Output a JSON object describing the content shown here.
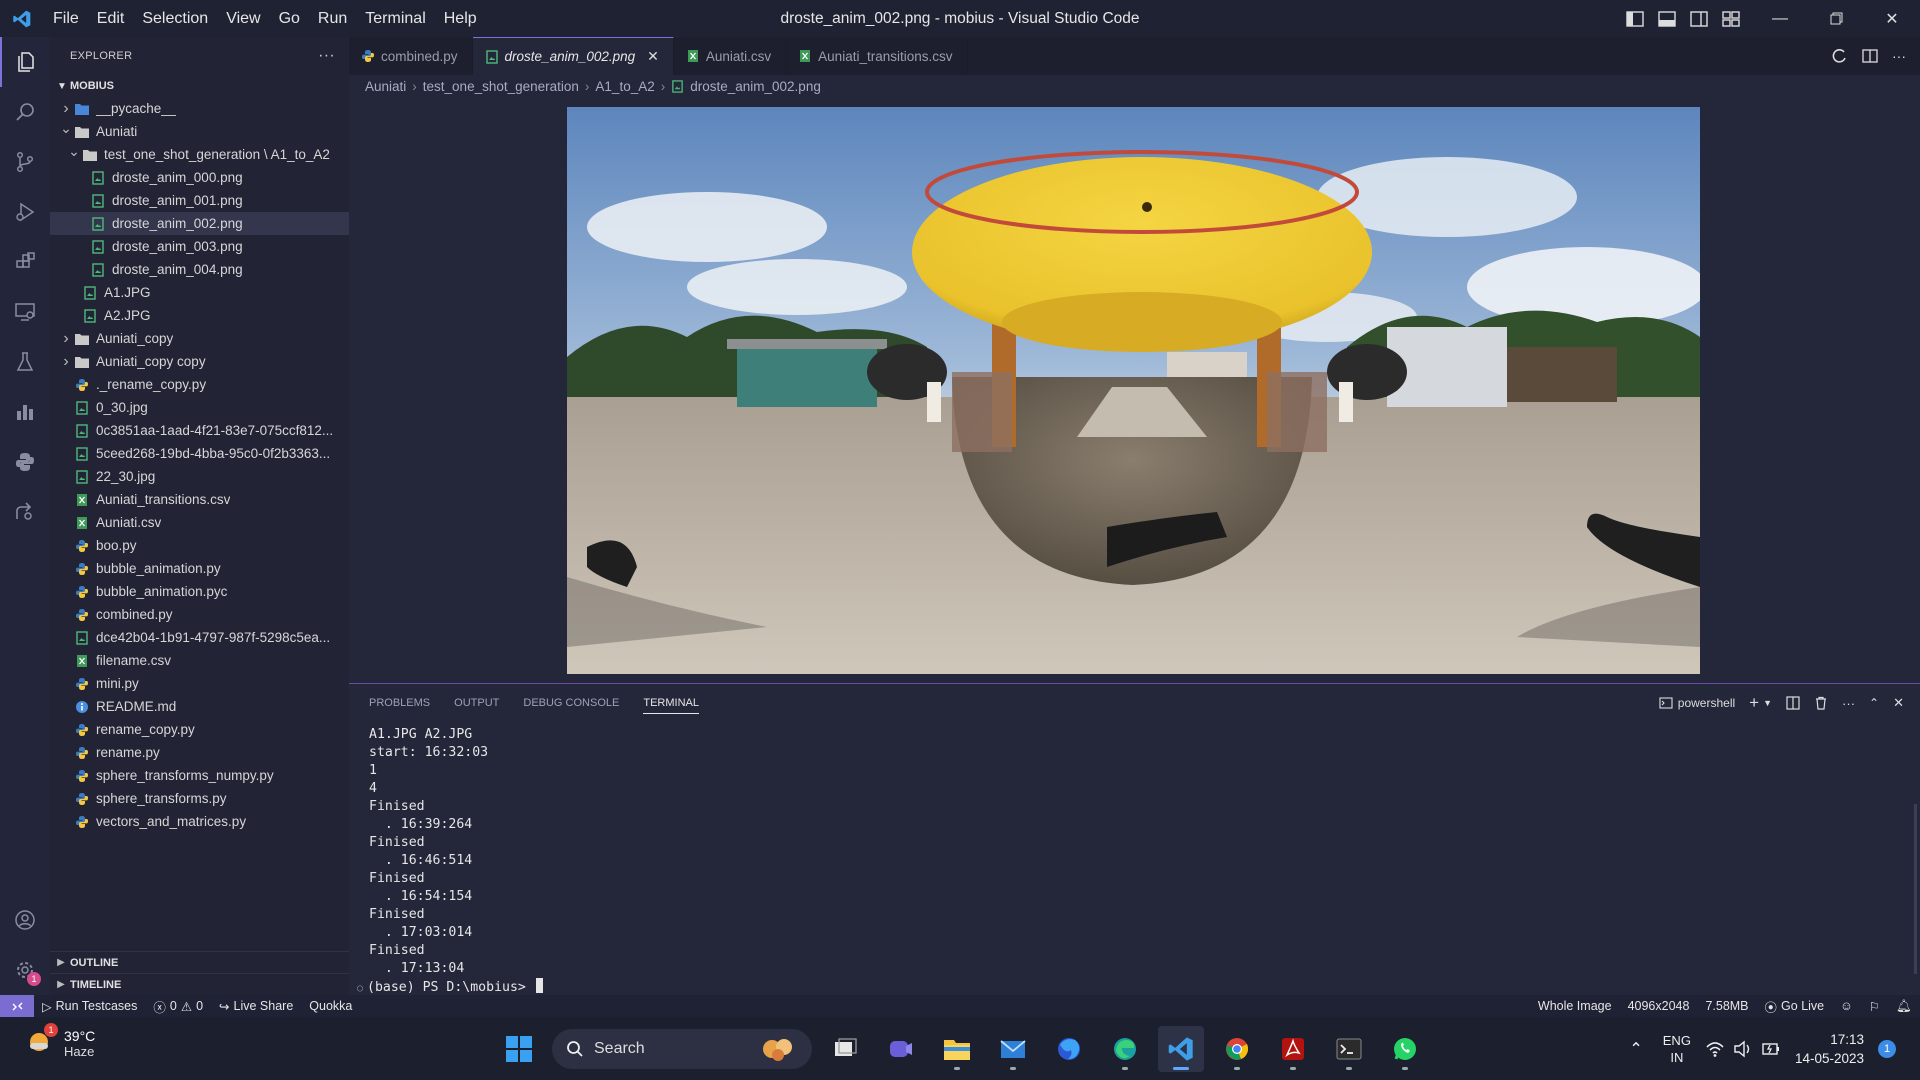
{
  "titlebar": {
    "menu": [
      "File",
      "Edit",
      "Selection",
      "View",
      "Go",
      "Run",
      "Terminal",
      "Help"
    ],
    "title": "droste_anim_002.png - mobius - Visual Studio Code"
  },
  "sidebar": {
    "header": "EXPLORER",
    "root": "MOBIUS",
    "tree": [
      {
        "label": "__pycache__",
        "type": "folder-blue",
        "indent": 0,
        "chev": "right"
      },
      {
        "label": "Auniati",
        "type": "folder",
        "indent": 0,
        "chev": "down"
      },
      {
        "label": "test_one_shot_generation \\ A1_to_A2",
        "type": "folder",
        "indent": 1,
        "chev": "down"
      },
      {
        "label": "droste_anim_000.png",
        "type": "image",
        "indent": 2
      },
      {
        "label": "droste_anim_001.png",
        "type": "image",
        "indent": 2
      },
      {
        "label": "droste_anim_002.png",
        "type": "image",
        "indent": 2,
        "selected": true
      },
      {
        "label": "droste_anim_003.png",
        "type": "image",
        "indent": 2
      },
      {
        "label": "droste_anim_004.png",
        "type": "image",
        "indent": 2
      },
      {
        "label": "A1.JPG",
        "type": "image",
        "indent": 1
      },
      {
        "label": "A2.JPG",
        "type": "image",
        "indent": 1
      },
      {
        "label": "Auniati_copy",
        "type": "folder",
        "indent": 0,
        "chev": "right"
      },
      {
        "label": "Auniati_copy copy",
        "type": "folder",
        "indent": 0,
        "chev": "right"
      },
      {
        "label": "._rename_copy.py",
        "type": "python",
        "indent": 0
      },
      {
        "label": "0_30.jpg",
        "type": "image",
        "indent": 0
      },
      {
        "label": "0c3851aa-1aad-4f21-83e7-075ccf812...",
        "type": "image",
        "indent": 0
      },
      {
        "label": "5ceed268-19bd-4bba-95c0-0f2b3363...",
        "type": "image",
        "indent": 0
      },
      {
        "label": "22_30.jpg",
        "type": "image",
        "indent": 0
      },
      {
        "label": "Auniati_transitions.csv",
        "type": "csv",
        "indent": 0
      },
      {
        "label": "Auniati.csv",
        "type": "csv",
        "indent": 0
      },
      {
        "label": "boo.py",
        "type": "python",
        "indent": 0
      },
      {
        "label": "bubble_animation.py",
        "type": "python",
        "indent": 0
      },
      {
        "label": "bubble_animation.pyc",
        "type": "python",
        "indent": 0
      },
      {
        "label": "combined.py",
        "type": "python",
        "indent": 0
      },
      {
        "label": "dce42b04-1b91-4797-987f-5298c5ea...",
        "type": "image",
        "indent": 0
      },
      {
        "label": "filename.csv",
        "type": "csv",
        "indent": 0
      },
      {
        "label": "mini.py",
        "type": "python",
        "indent": 0
      },
      {
        "label": "README.md",
        "type": "info",
        "indent": 0
      },
      {
        "label": "rename_copy.py",
        "type": "python",
        "indent": 0
      },
      {
        "label": "rename.py",
        "type": "python",
        "indent": 0
      },
      {
        "label": "sphere_transforms_numpy.py",
        "type": "python",
        "indent": 0
      },
      {
        "label": "sphere_transforms.py",
        "type": "python",
        "indent": 0
      },
      {
        "label": "vectors_and_matrices.py",
        "type": "python",
        "indent": 0
      }
    ],
    "outline": "OUTLINE",
    "timeline": "TIMELINE"
  },
  "tabs": [
    {
      "label": "combined.py",
      "type": "python"
    },
    {
      "label": "droste_anim_002.png",
      "type": "image",
      "active": true
    },
    {
      "label": "Auniati.csv",
      "type": "csv"
    },
    {
      "label": "Auniati_transitions.csv",
      "type": "csv"
    }
  ],
  "breadcrumb": [
    "Auniati",
    "test_one_shot_generation",
    "A1_to_A2",
    "droste_anim_002.png"
  ],
  "panel": {
    "tabs": [
      "PROBLEMS",
      "OUTPUT",
      "DEBUG CONSOLE",
      "TERMINAL"
    ],
    "active_tab": "TERMINAL",
    "shell": "powershell",
    "terminal_lines": [
      "A1.JPG A2.JPG",
      "start: 16:32:03",
      "1",
      "4",
      "Finised",
      "  . 16:39:264",
      "Finised",
      "  . 16:46:514",
      "Finised",
      "  . 16:54:154",
      "Finised",
      "  . 17:03:014",
      "Finised",
      "  . 17:13:04"
    ],
    "prompt": "(base) PS D:\\mobius> "
  },
  "statusbar": {
    "run_testcases": "Run Testcases",
    "errors": "0",
    "warnings": "0",
    "live_share": "Live Share",
    "quokka": "Quokka",
    "whole_image": "Whole Image",
    "dimensions": "4096x2048",
    "size": "7.58MB",
    "go_live": "Go Live"
  },
  "taskbar": {
    "temperature": "39°C",
    "weather": "Haze",
    "search_placeholder": "Search",
    "lang1": "ENG",
    "lang2": "IN",
    "time": "17:13",
    "date": "14-05-2023",
    "notification_count": "1",
    "weather_badge": "1"
  },
  "colors": {
    "accent": "#7a73d8",
    "statusbar_remote": "#7a6cd0",
    "panel_border": "#6a4ca6"
  }
}
